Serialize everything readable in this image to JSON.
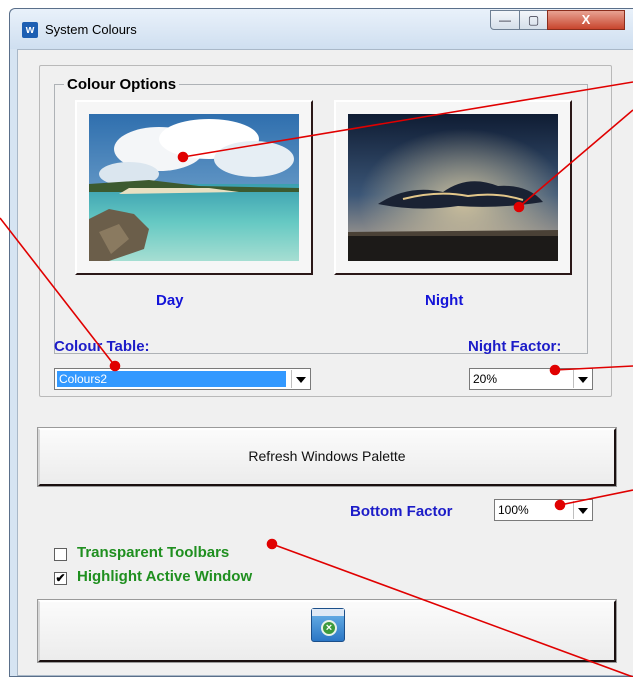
{
  "window": {
    "title": "System Colours",
    "app_icon": "w"
  },
  "caption_buttons": {
    "minimize": "—",
    "maximize": "▢",
    "close": "X"
  },
  "colour_options": {
    "legend": "Colour Options",
    "day_label": "Day",
    "night_label": "Night"
  },
  "colour_table": {
    "label": "Colour Table:",
    "value": "Colours2"
  },
  "night_factor": {
    "label": "Night Factor:",
    "value": "20%"
  },
  "refresh_button": {
    "label": "Refresh Windows Palette"
  },
  "bottom_factor": {
    "label": "Bottom Factor",
    "value": "100%"
  },
  "options": {
    "transparent_toolbars": {
      "label": "Transparent Toolbars",
      "checked": false
    },
    "highlight_active_window": {
      "label": "Highlight Active Window",
      "checked": true,
      "mark": "✔"
    }
  },
  "exit_button": {
    "icon": "exit-window-icon"
  },
  "colors": {
    "label_blue": "#1c1cc8",
    "label_green": "#1f8f1f",
    "callout_red": "#e00000",
    "selection": "#3399ff"
  }
}
